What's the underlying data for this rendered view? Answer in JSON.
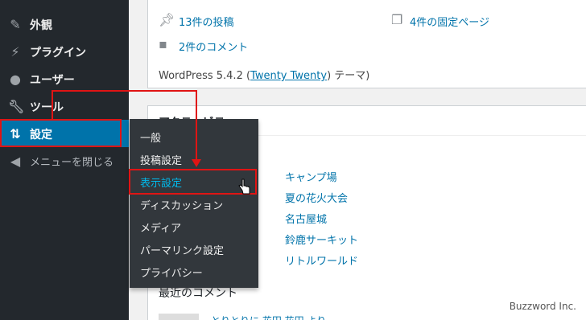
{
  "sidebar": {
    "items": [
      {
        "label": "外観",
        "icon": "paintbrush-icon"
      },
      {
        "label": "プラグイン",
        "icon": "plugin-icon"
      },
      {
        "label": "ユーザー",
        "icon": "user-icon"
      },
      {
        "label": "ツール",
        "icon": "wrench-icon"
      },
      {
        "label": "設定",
        "icon": "settings-icon",
        "active": true
      },
      {
        "label": "メニューを閉じる",
        "icon": "collapse-icon"
      }
    ]
  },
  "submenu": {
    "items": [
      "一般",
      "投稿設定",
      "表示設定",
      "ディスカッション",
      "メディア",
      "パーマリンク設定",
      "プライバシー"
    ],
    "highlighted": "表示設定"
  },
  "glance": {
    "posts": "13件の投稿",
    "pages": "4件の固定ページ",
    "comments": "2件のコメント",
    "version_prefix": "WordPress 5.4.2 (",
    "theme": "Twenty Twenty",
    "version_suffix": ") テーマ)"
  },
  "activity": {
    "title": "アクティビティ",
    "posts": [
      "キャンプ場",
      "夏の花火大会",
      "名古屋城",
      "鈴鹿サーキット",
      "リトルワールド"
    ],
    "recent_comments": "最近のコメント",
    "comment_snippet": "とりとりに 花田 花田 より"
  },
  "watermark": "Buzzword Inc.",
  "colors": {
    "sidebar": "#23282d",
    "active": "#0073aa",
    "link": "#0073aa",
    "annotation": "#e01414"
  }
}
